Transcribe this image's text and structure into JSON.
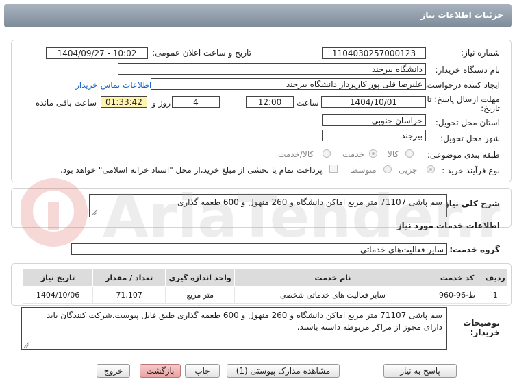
{
  "header": {
    "title": "جزئیات اطلاعات نیاز"
  },
  "info": {
    "need_number_label": "شماره نیاز:",
    "need_number": "1104030257000123",
    "announce_label": "تاریخ و ساعت اعلان عمومی:",
    "announce_value": "1404/09/27 - 10:02",
    "buyer_org_label": "نام دستگاه خریدار:",
    "buyer_org": "دانشگاه بیرجند",
    "creator_label": "ایجاد کننده درخواست:",
    "creator": "علیرضا قلی پور کارپرداز دانشگاه بیرجند",
    "contact_link": "اطلاعات تماس خریدار",
    "deadline_label_1": "مهلت ارسال پاسخ: تا",
    "deadline_label_2": "تاریخ:",
    "deadline_date": "1404/10/01",
    "time_label": "ساعت",
    "deadline_time": "12:00",
    "days_value": "4",
    "days_label": "روز و",
    "remaining_time": "01:33:42",
    "remaining_label": "ساعت باقی مانده",
    "province_label": "استان محل تحویل:",
    "province": "خراسان جنوبی",
    "city_label": "شهر محل تحویل:",
    "city": "بیرجند",
    "category_label": "طبقه بندی موضوعی:",
    "category_options": [
      "کالا",
      "خدمت",
      "کالا/خدمت"
    ],
    "process_label": "نوع فرآیند خرید :",
    "process_options": [
      "جزیی",
      "متوسط"
    ],
    "payment_note": "پرداخت تمام یا بخشی از مبلغ خرید،از محل \"اسناد خزانه اسلامی\" خواهد بود."
  },
  "summary": {
    "label": "شرح کلی نیاز:",
    "text": "سم پاشی 71107 متر مربع اماکن دانشگاه و 260 منهول و 600 طعمه گذاری"
  },
  "services": {
    "heading": "اطلاعات خدمات مورد نیاز",
    "group_label": "گروه خدمت:",
    "group_value": "سایر فعالیت‌های خدماتی",
    "columns": [
      "ردیف",
      "کد خدمت",
      "نام خدمت",
      "واحد اندازه گیری",
      "تعداد / مقدار",
      "تاریخ نیاز"
    ],
    "rows": [
      [
        "1",
        "ط-96-960",
        "سایر فعالیت های خدماتی شخصی",
        "متر مربع",
        "71,107",
        "1404/10/06"
      ]
    ]
  },
  "notes": {
    "label_1": "توضیحات",
    "label_2": "خریدار:",
    "text": "سم پاشی 71107 متر مربع اماکن دانشگاه و 260 منهول و 600 طعمه گذاری طبق فایل پیوست.شرکت کنندگان باید دارای مجوز از مراکز مربوطه داشته باشند."
  },
  "buttons": {
    "reply": "پاسخ به نیاز",
    "view_docs": "مشاهده مدارک پیوستی (1)",
    "print": "چاپ",
    "back": "بازگشت",
    "exit": "خروج"
  },
  "watermark": {
    "brand": "AriaTender.net"
  },
  "colors": {
    "title_bar": "#8c98a5",
    "timer_bg": "#fff3b0",
    "link": "#1a66cc",
    "danger_btn": "#eba3a3"
  }
}
